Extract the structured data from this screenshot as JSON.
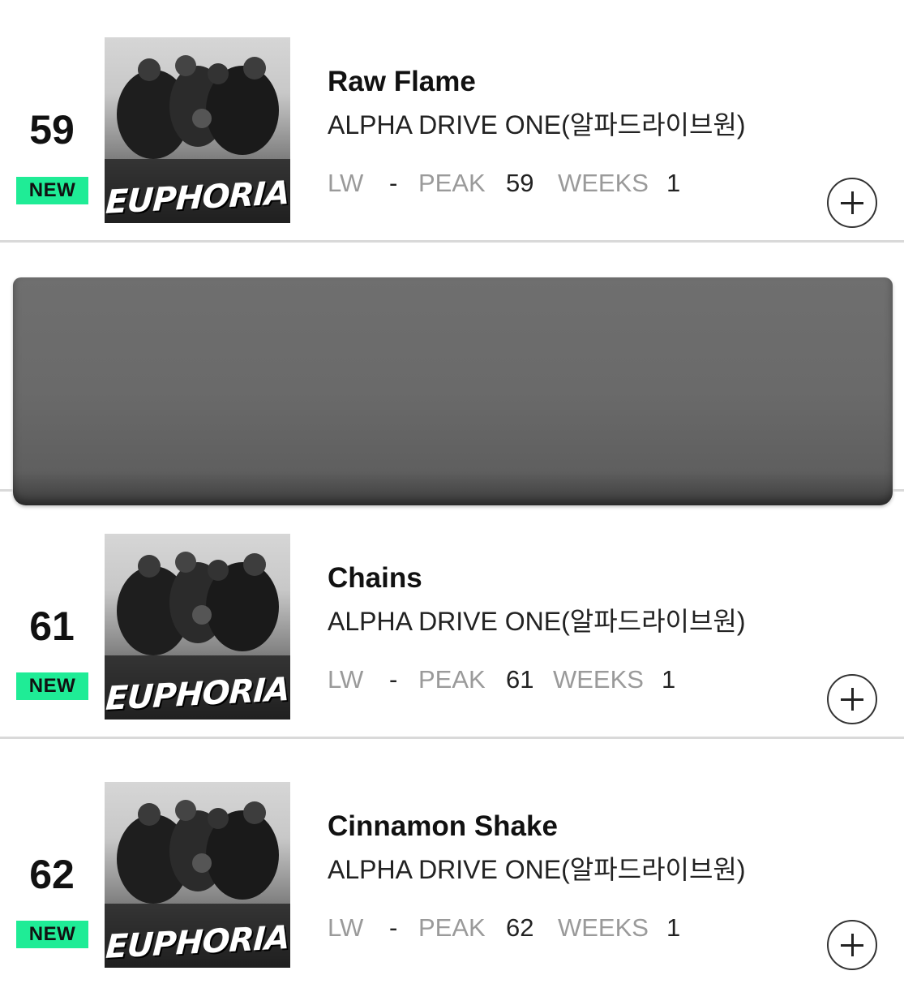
{
  "chart": {
    "entries": [
      {
        "rank": "59",
        "badge": "NEW",
        "title": "Raw Flame",
        "artist": "ALPHA DRIVE ONE(알파드라이브원)",
        "cover_text": "EUPHORIA",
        "lw_label": "LW",
        "lw_value": "-",
        "peak_label": "PEAK",
        "peak_value": "59",
        "weeks_label": "WEEKS",
        "weeks_value": "1",
        "add_icon": "plus-circle-icon"
      },
      {
        "rank": "61",
        "badge": "NEW",
        "title": "Chains",
        "artist": "ALPHA DRIVE ONE(알파드라이브원)",
        "cover_text": "EUPHORIA",
        "lw_label": "LW",
        "lw_value": "-",
        "peak_label": "PEAK",
        "peak_value": "61",
        "weeks_label": "WEEKS",
        "weeks_value": "1",
        "add_icon": "plus-circle-icon"
      },
      {
        "rank": "62",
        "badge": "NEW",
        "title": "Cinnamon Shake",
        "artist": "ALPHA DRIVE ONE(알파드라이브원)",
        "cover_text": "EUPHORIA",
        "lw_label": "LW",
        "lw_value": "-",
        "peak_label": "PEAK",
        "peak_value": "62",
        "weeks_label": "WEEKS",
        "weeks_value": "1",
        "add_icon": "plus-circle-icon"
      }
    ]
  },
  "colors": {
    "new_badge": "#1fec96",
    "label_gray": "#9a9a9a",
    "divider": "#d9d9d9",
    "redaction": "#6a6a6a"
  }
}
